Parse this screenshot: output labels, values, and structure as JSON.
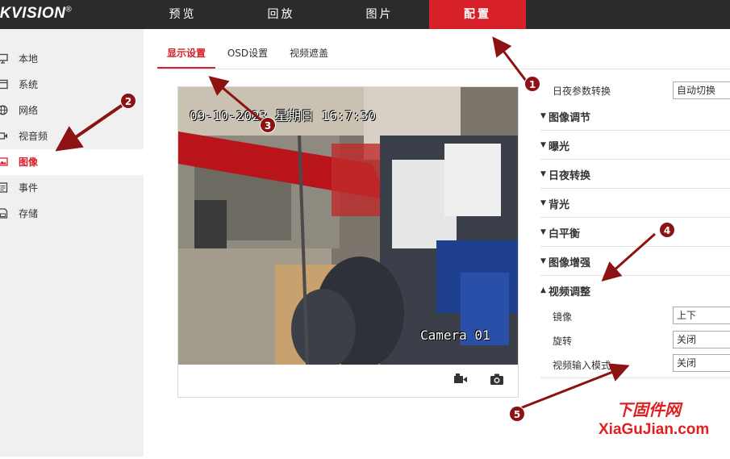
{
  "brand": {
    "logo_text": "IKVISION",
    "reg_mark": "®"
  },
  "nav": {
    "items": [
      {
        "label": "预览"
      },
      {
        "label": "回放"
      },
      {
        "label": "图片"
      },
      {
        "label": "配置",
        "active": true
      }
    ]
  },
  "sidebar": {
    "items": [
      {
        "label": "本地",
        "icon": "monitor-icon"
      },
      {
        "label": "系统",
        "icon": "system-icon"
      },
      {
        "label": "网络",
        "icon": "network-icon"
      },
      {
        "label": "视音频",
        "icon": "audio-video-icon"
      },
      {
        "label": "图像",
        "icon": "image-icon",
        "active": true
      },
      {
        "label": "事件",
        "icon": "event-icon"
      },
      {
        "label": "存储",
        "icon": "storage-icon"
      }
    ]
  },
  "tabs": [
    {
      "label": "显示设置",
      "active": true
    },
    {
      "label": "OSD设置"
    },
    {
      "label": "视频遮盖"
    }
  ],
  "preview": {
    "osd_time": "09-10-2023 星期日 16:7:30",
    "osd_name": "Camera 01",
    "controls": [
      "record-icon",
      "snapshot-icon"
    ]
  },
  "settings": {
    "day_night_label": "日夜参数转换",
    "day_night_value": "自动切换",
    "sections": [
      {
        "label": "图像调节",
        "expanded": false
      },
      {
        "label": "曝光",
        "expanded": false
      },
      {
        "label": "日夜转换",
        "expanded": false
      },
      {
        "label": "背光",
        "expanded": false
      },
      {
        "label": "白平衡",
        "expanded": false
      },
      {
        "label": "图像增强",
        "expanded": false
      },
      {
        "label": "视频调整",
        "expanded": true
      }
    ],
    "video_adjust": {
      "mirror_label": "镜像",
      "mirror_value": "上下",
      "rotate_label": "旋转",
      "rotate_value": "关闭",
      "input_mode_label": "视频输入模式",
      "input_mode_value": "关闭"
    }
  },
  "annotations": {
    "badges": [
      "1",
      "2",
      "3",
      "4",
      "5"
    ],
    "color": "#8c1214"
  },
  "watermark": {
    "line1": "下固件网",
    "line2": "XiaGuJian.com"
  },
  "colors": {
    "accent": "#d8202a",
    "topbar": "#2b2b2b",
    "sidebar": "#f0f0f0"
  }
}
